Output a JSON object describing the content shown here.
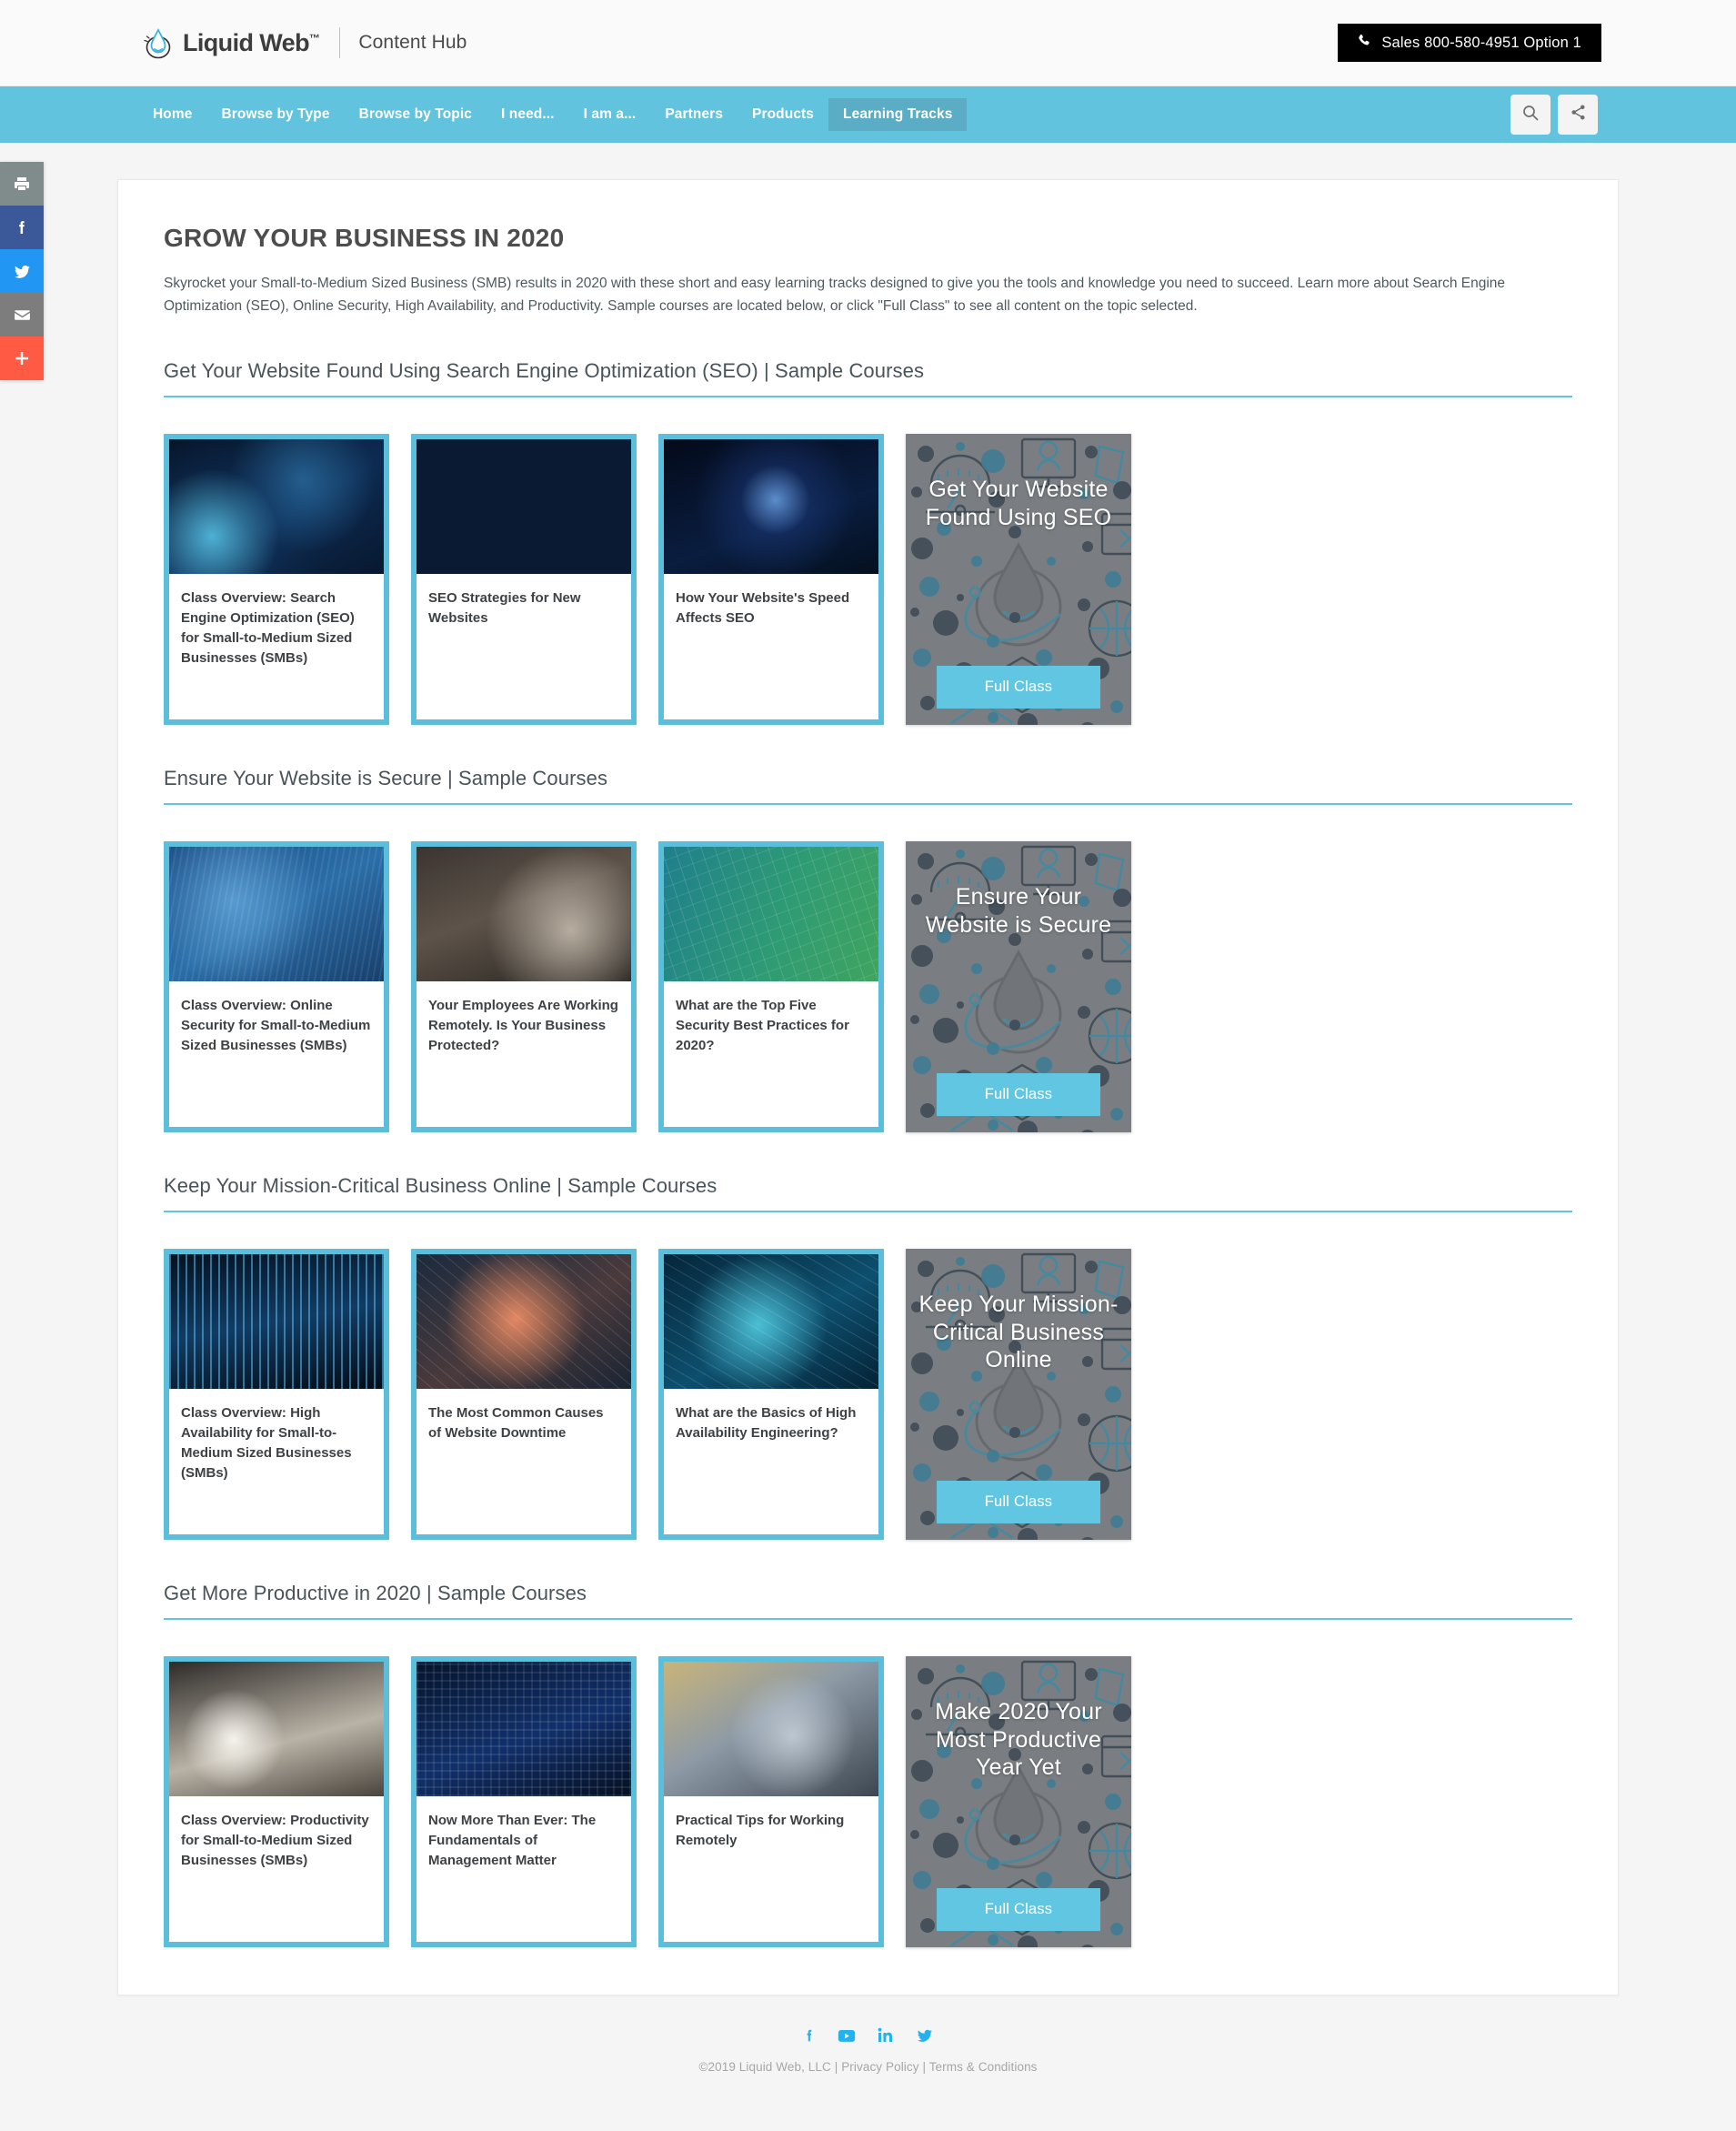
{
  "header": {
    "brand_name": "Liquid Web",
    "brand_tm": "™",
    "sub_brand": "Content Hub",
    "phone_label": "Sales 800-580-4951 Option 1",
    "phone_icon": "phone-icon",
    "logo_icon": "liquid-web-droplet-logo"
  },
  "nav": {
    "items": [
      {
        "label": "Home",
        "active": false
      },
      {
        "label": "Browse by Type",
        "active": false
      },
      {
        "label": "Browse by Topic",
        "active": false
      },
      {
        "label": "I need...",
        "active": false
      },
      {
        "label": "I am a...",
        "active": false
      },
      {
        "label": "Partners",
        "active": false
      },
      {
        "label": "Products",
        "active": false
      },
      {
        "label": "Learning Tracks",
        "active": true
      }
    ],
    "tools": [
      {
        "name": "search-icon"
      },
      {
        "name": "share-icon"
      }
    ],
    "bar_color": "#61c3de",
    "active_color": "#5badc5"
  },
  "social_rail": [
    {
      "name": "print-icon",
      "color": "#7f8c8b"
    },
    {
      "name": "facebook-icon",
      "color": "#3b5998"
    },
    {
      "name": "twitter-icon",
      "color": "#2196f3"
    },
    {
      "name": "email-icon",
      "color": "#7d7d7d"
    },
    {
      "name": "more-share-icon",
      "color": "#ff5a44"
    }
  ],
  "main": {
    "title": "GROW YOUR BUSINESS IN 2020",
    "intro": "Skyrocket your Small-to-Medium Sized Business (SMB) results in 2020 with these short and easy learning tracks designed to give you the tools and knowledge you need to succeed. Learn more about Search Engine Optimization (SEO), Online Security, High Availability, and Productivity. Sample courses are located below, or click \"Full Class\" to see all content on the topic selected.",
    "sections": [
      {
        "heading": "Get Your Website Found Using Search Engine Optimization (SEO) | Sample Courses",
        "courses": [
          {
            "title": "Class Overview: Search Engine Optimization (SEO) for Small-to-Medium Sized Businesses (SMBs)",
            "thumb": "particles-blue"
          },
          {
            "title": "SEO Strategies for New Websites",
            "thumb": "circuit-blue"
          },
          {
            "title": "How Your Website's Speed Affects SEO",
            "thumb": "nebula-blue"
          }
        ],
        "promo": {
          "title": "Get Your Website Found Using SEO",
          "button": "Full Class"
        }
      },
      {
        "heading": "Ensure Your Website is Secure | Sample Courses",
        "courses": [
          {
            "title": "Class Overview: Online Security for Small-to-Medium Sized Businesses (SMBs)",
            "thumb": "datacode-blue"
          },
          {
            "title": "Your Employees Are Working Remotely. Is Your Business Protected?",
            "thumb": "desk-photo"
          },
          {
            "title": "What are the Top Five Security Best Practices for 2020?",
            "thumb": "grid-green"
          }
        ],
        "promo": {
          "title": "Ensure Your Website is Secure",
          "button": "Full Class"
        }
      },
      {
        "heading": "Keep Your Mission-Critical Business Online | Sample Courses",
        "courses": [
          {
            "title": "Class Overview: High Availability for Small-to-Medium Sized Businesses (SMBs)",
            "thumb": "server-rack"
          },
          {
            "title": "The Most Common Causes of Website Downtime",
            "thumb": "orange-mesh"
          },
          {
            "title": "What are the Basics of High Availability Engineering?",
            "thumb": "cyan-mesh"
          }
        ],
        "promo": {
          "title": "Keep Your Mission-Critical Business Online",
          "button": "Full Class"
        }
      },
      {
        "heading": "Get More Productive in 2020 | Sample Courses",
        "courses": [
          {
            "title": "Class Overview: Productivity for Small-to-Medium Sized Businesses (SMBs)",
            "thumb": "desk-mug"
          },
          {
            "title": "Now More Than Ever: The Fundamentals of Management Matter",
            "thumb": "keyboard-blue"
          },
          {
            "title": "Practical Tips for Working Remotely",
            "thumb": "man-headset"
          }
        ],
        "promo": {
          "title": "Make 2020 Your Most Productive Year Yet",
          "button": "Full Class"
        }
      }
    ]
  },
  "footer": {
    "social": [
      {
        "name": "facebook-icon"
      },
      {
        "name": "youtube-icon"
      },
      {
        "name": "linkedin-icon"
      },
      {
        "name": "twitter-icon"
      }
    ],
    "copyright": "©2019 Liquid Web, LLC",
    "sep1": "|",
    "privacy": "Privacy Policy",
    "sep2": "|",
    "terms": "Terms & Conditions"
  },
  "colors": {
    "accent": "#61c3de",
    "card_border": "#5bbedb",
    "promo_bg": "#7a7e82",
    "promo_button": "#61c6e2"
  }
}
